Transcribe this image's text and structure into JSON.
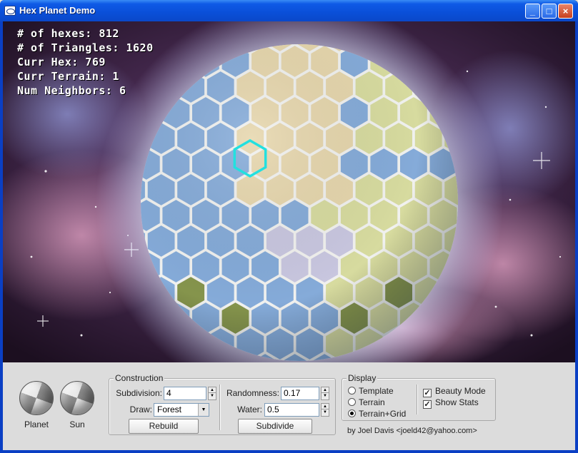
{
  "window": {
    "title": "Hex Planet Demo",
    "minimize_glyph": "_",
    "maximize_glyph": "□",
    "close_glyph": "×"
  },
  "stats": [
    "# of hexes: 812",
    "# of Triangles: 1620",
    "Curr Hex: 769",
    "Curr Terrain: 1",
    "Num Neighbors: 6"
  ],
  "trackballs": {
    "planet": "Planet",
    "sun": "Sun"
  },
  "construction": {
    "legend": "Construction",
    "subdivision_label": "Subdivision:",
    "subdivision_value": "4",
    "draw_label": "Draw:",
    "draw_value": "Forest",
    "rebuild_button": "Rebuild",
    "randomness_label": "Randomness:",
    "randomness_value": "0.17",
    "water_label": "Water:",
    "water_value": "0.5",
    "subdivide_button": "Subdivide"
  },
  "display": {
    "legend": "Display",
    "radios": [
      {
        "label": "Template",
        "selected": false
      },
      {
        "label": "Terrain",
        "selected": false
      },
      {
        "label": "Terrain+Grid",
        "selected": true
      }
    ],
    "checks": [
      {
        "label": "Beauty Mode",
        "checked": true
      },
      {
        "label": "Show Stats",
        "checked": true
      }
    ]
  },
  "credit": "by Joel Davis <joeld42@yahoo.com>",
  "colors": {
    "titlebar": "#0a4fd8",
    "selected_hex": "#22e0e0",
    "hex_water": "#7fa8d8",
    "hex_sand": "#e9d6a8",
    "hex_grass": "#d8dc9a",
    "hex_forest": "#7f8f3f",
    "hex_snow": "#c9c6e0"
  },
  "icons": {
    "window_icon": "app-window-icon",
    "trackball": "trackball-sphere-icon"
  }
}
